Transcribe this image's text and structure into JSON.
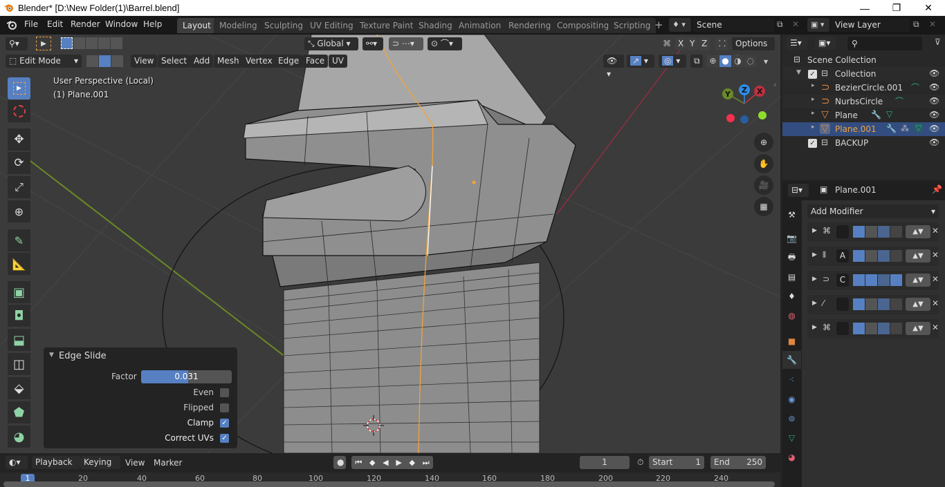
{
  "window": {
    "title": "Blender* [D:\\New Folder(1)\\Barrel.blend]",
    "controls": [
      "minimize",
      "restore",
      "close"
    ]
  },
  "menu": [
    "File",
    "Edit",
    "Render",
    "Window",
    "Help"
  ],
  "workspaces": [
    {
      "label": "Layout",
      "active": true
    },
    {
      "label": "Modeling"
    },
    {
      "label": "Sculpting"
    },
    {
      "label": "UV Editing"
    },
    {
      "label": "Texture Paint"
    },
    {
      "label": "Shading"
    },
    {
      "label": "Animation"
    },
    {
      "label": "Rendering"
    },
    {
      "label": "Compositing"
    },
    {
      "label": "Scripting"
    }
  ],
  "add_workspace": "+",
  "scene": {
    "name": "Scene"
  },
  "view_layer": {
    "name": "View Layer"
  },
  "viewport": {
    "mode": "Edit Mode",
    "menus": [
      "View",
      "Select",
      "Add",
      "Mesh",
      "Vertex",
      "Edge",
      "Face",
      "UV"
    ],
    "transform_orientation": "Global",
    "mirror_axes": [
      "X",
      "Y",
      "Z"
    ],
    "options_label": "Options",
    "info_line1": "User Perspective (Local)",
    "info_line2": "(1) Plane.001",
    "gizmo": {
      "x": "X",
      "y": "Y",
      "z": "Z"
    },
    "shading_modes": [
      "wireframe",
      "solid",
      "material",
      "rendered"
    ],
    "active_shading": "solid"
  },
  "operator_panel": {
    "title": "Edge Slide",
    "factor_label": "Factor",
    "factor_value": "0.031",
    "factor_fraction": 0.52,
    "options": [
      {
        "label": "Even",
        "checked": false
      },
      {
        "label": "Flipped",
        "checked": false
      },
      {
        "label": "Clamp",
        "checked": true
      },
      {
        "label": "Correct UVs",
        "checked": true
      }
    ]
  },
  "outliner": {
    "root": "Scene Collection",
    "items": [
      {
        "label": "Collection",
        "type": "collection",
        "checked": true
      },
      {
        "label": "BezierCircle.001",
        "type": "curve"
      },
      {
        "label": "NurbsCircle",
        "type": "curve"
      },
      {
        "label": "Plane",
        "type": "mesh"
      },
      {
        "label": "Plane.001",
        "type": "mesh",
        "selected": true
      },
      {
        "label": "BACKUP",
        "type": "collection",
        "checked": true
      }
    ]
  },
  "properties": {
    "object_name": "Plane.001",
    "add_modifier_label": "Add Modifier",
    "modifiers": [
      {
        "icon": "mirror",
        "name": ""
      },
      {
        "icon": "array",
        "name": "A"
      },
      {
        "icon": "curve",
        "name": "C"
      },
      {
        "icon": "simple-deform",
        "name": ""
      },
      {
        "icon": "mirror",
        "name": ""
      }
    ]
  },
  "timeline": {
    "menus": [
      "Playback",
      "Keying",
      "View",
      "Marker"
    ],
    "current_frame": "1",
    "start_label": "Start",
    "start": "1",
    "end_label": "End",
    "end": "250",
    "ruler": [
      "1",
      "20",
      "40",
      "60",
      "80",
      "100",
      "120",
      "140",
      "160",
      "180",
      "200",
      "220",
      "240"
    ]
  },
  "colors": {
    "accent": "#5680c2",
    "selected_text": "#f3a33a",
    "header": "#181818",
    "viewport_bg": "#3b3b3b"
  }
}
